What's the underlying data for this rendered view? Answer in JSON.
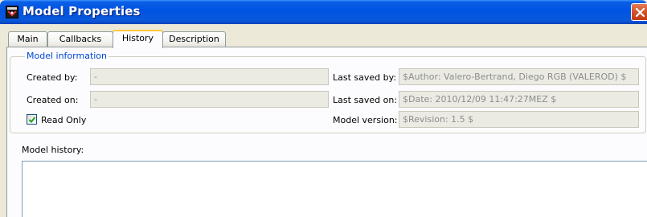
{
  "window": {
    "title": "Model Properties"
  },
  "tabs": [
    {
      "label": "Main",
      "active": false
    },
    {
      "label": "Callbacks",
      "active": false
    },
    {
      "label": "History",
      "active": true
    },
    {
      "label": "Description",
      "active": false
    }
  ],
  "model_info": {
    "group_title": "Model information",
    "created_by_label": "Created by:",
    "created_by_value": "-",
    "created_on_label": "Created on:",
    "created_on_value": "-",
    "read_only_label": "Read Only",
    "read_only_checked": true,
    "last_saved_by_label": "Last saved by:",
    "last_saved_by_value": "$Author: Valero-Bertrand, Diego RGB (VALEROD) $",
    "last_saved_on_label": "Last saved on:",
    "last_saved_on_value": "$Date: 2010/12/09 11:47:27MEZ $",
    "model_version_label": "Model version:",
    "model_version_value": "$Revision: 1.5 $"
  },
  "history": {
    "label": "Model history:",
    "value": ""
  },
  "colors": {
    "titlebar": "#0054e3",
    "group_title": "#0046d5",
    "active_tab_accent": "#ffc83c",
    "close_button": "#d2522a"
  },
  "icons": [
    "model-app-icon",
    "close-icon",
    "checkmark-icon"
  ]
}
